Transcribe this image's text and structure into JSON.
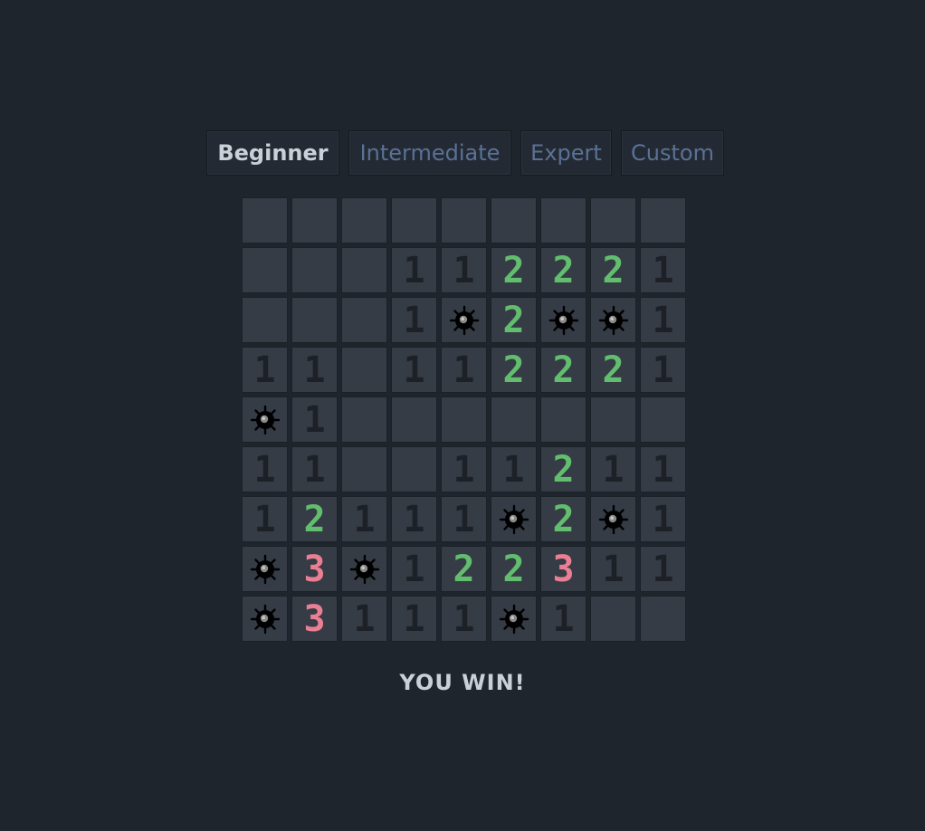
{
  "difficulty_tabs": [
    {
      "label": "Beginner",
      "active": true
    },
    {
      "label": "Intermediate",
      "active": false
    },
    {
      "label": "Expert",
      "active": false
    },
    {
      "label": "Custom",
      "active": false
    }
  ],
  "board": {
    "rows": 9,
    "cols": 9,
    "cells": [
      [
        "",
        "",
        "",
        "",
        "",
        "",
        "",
        "",
        ""
      ],
      [
        "",
        "",
        "",
        "1",
        "1",
        "2",
        "2",
        "2",
        "1"
      ],
      [
        "",
        "",
        "",
        "1",
        "*",
        "2",
        "*",
        "*",
        "1"
      ],
      [
        "1",
        "1",
        "",
        "1",
        "1",
        "2",
        "2",
        "2",
        "1"
      ],
      [
        "*",
        "1",
        "",
        "",
        "",
        "",
        "",
        "",
        ""
      ],
      [
        "1",
        "1",
        "",
        "",
        "1",
        "1",
        "2",
        "1",
        "1"
      ],
      [
        "1",
        "2",
        "1",
        "1",
        "1",
        "*",
        "2",
        "*",
        "1"
      ],
      [
        "*",
        "3",
        "*",
        "1",
        "2",
        "2",
        "3",
        "1",
        "1"
      ],
      [
        "*",
        "3",
        "1",
        "1",
        "1",
        "*",
        "1",
        "",
        ""
      ]
    ],
    "mine_icon": "mine-icon"
  },
  "status": {
    "text": "YOU WIN!"
  },
  "colors": {
    "background": "#1f252d",
    "cell": "#353c46",
    "number_1": "#1d2127",
    "number_2": "#62bd6e",
    "number_3": "#ea7f94",
    "tab_active_text": "#c9d0d8",
    "tab_text": "#5a7196"
  }
}
